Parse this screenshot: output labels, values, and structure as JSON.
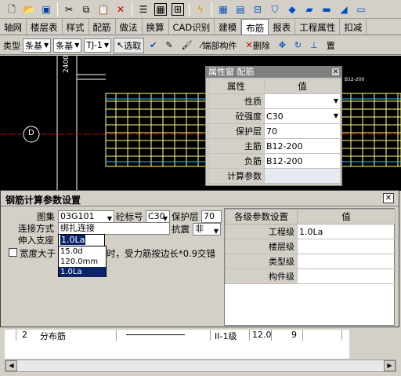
{
  "toolbar": {
    "icons": [
      "new-icon",
      "open-icon",
      "save-icon",
      "cut-icon",
      "copy-icon",
      "paste-icon",
      "delete-icon",
      "list-icon",
      "table-icon",
      "property-icon",
      "lightning-icon",
      "grid-icon",
      "view1-icon",
      "view2-icon",
      "view3-icon",
      "view4-icon",
      "view5-icon",
      "view6-icon",
      "view7-icon",
      "view8-icon"
    ]
  },
  "tabs": [
    "轴网",
    "楼层表",
    "样式",
    "配筋",
    "做法",
    "换算",
    "CAD识别",
    "建模",
    "布筋",
    "报表",
    "工程属性",
    "扣减"
  ],
  "active_tab": "布筋",
  "subtoolbar": {
    "type_label": "类型",
    "type1": "条基",
    "type2": "条基",
    "type3": "TJ-1",
    "select": "选取",
    "end_component": "端部构件",
    "delete": "删除",
    "last": "置"
  },
  "canvas": {
    "dim_text": "2400",
    "axis_label": "D",
    "small_label": "B12-200"
  },
  "prop_window": {
    "title": "属性窗 配筋",
    "col_attr": "属性",
    "col_val": "值",
    "rows": [
      {
        "k": "性质",
        "v": "",
        "dropdown": true
      },
      {
        "k": "砼强度",
        "v": "C30",
        "dropdown": true
      },
      {
        "k": "保护层",
        "v": "70",
        "dropdown": false
      },
      {
        "k": "主筋",
        "v": "B12-200",
        "dropdown": false
      },
      {
        "k": "负筋",
        "v": "B12-200",
        "dropdown": false
      },
      {
        "k": "计算参数",
        "v": "",
        "dropdown": false
      }
    ]
  },
  "dialog": {
    "title": "钢筋计算参数设置",
    "atlas_label": "图集",
    "atlas_value": "03G101",
    "grade_label": "砼标号",
    "grade_value": "C30",
    "cover_label": "保护层",
    "cover_value": "70",
    "connect_label": "连接方式",
    "connect_value": "绑扎连接",
    "seismic_label": "抗震",
    "seismic_value": "非",
    "anchor_label": "伸入支座",
    "anchor_value": "1.0La",
    "width_label": "宽度大于",
    "width_suffix": "时，受力筋按边长*0.9交错",
    "options": [
      "15.0d",
      "120.0mm",
      "1.0La"
    ],
    "selected_option": "1.0La",
    "param_header": "各级参数设置",
    "value_header": "值",
    "params": [
      {
        "k": "工程级",
        "v": "1.0La"
      },
      {
        "k": "楼层级",
        "v": ""
      },
      {
        "k": "类型级",
        "v": ""
      },
      {
        "k": "构件级",
        "v": ""
      }
    ]
  },
  "bottom_row": {
    "index": "2",
    "name": "分布筋",
    "grade": "II-1级",
    "dia": "12.0",
    "count": "9"
  }
}
